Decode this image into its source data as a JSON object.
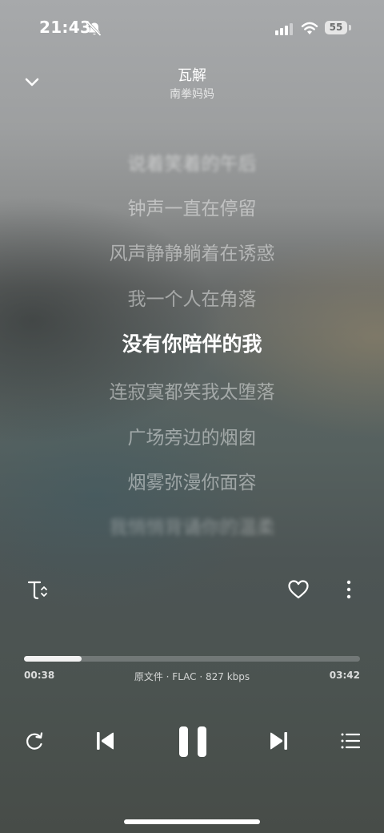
{
  "status_bar": {
    "time": "21:43",
    "battery_level": "55",
    "icons": [
      "bell-muted-icon",
      "cellular-signal-icon",
      "wifi-icon",
      "battery-icon"
    ]
  },
  "header": {
    "title": "瓦解",
    "artist": "南拳妈妈",
    "collapse_icon": "chevron-down-icon"
  },
  "lyrics": {
    "lines": [
      "说着笑着的午后",
      "钟声一直在停留",
      "风声静静躺着在诱惑",
      "我一个人在角落",
      "没有你陪伴的我",
      "连寂寞都笑我太堕落",
      "广场旁边的烟囱",
      "烟雾弥漫你面容",
      "我悄悄背诵你的温柔"
    ],
    "active_index": 4
  },
  "actions": {
    "text_size_icon": "text-size-icon",
    "like_icon": "heart-icon",
    "more_icon": "more-vertical-icon"
  },
  "progress": {
    "elapsed": "00:38",
    "total": "03:42",
    "fraction": 0.171,
    "file_info": "原文件 · FLAC · 827 kbps"
  },
  "controls": {
    "repeat_icon": "repeat-icon",
    "prev_icon": "skip-previous-icon",
    "pause_icon": "pause-icon",
    "next_icon": "skip-next-icon",
    "playlist_icon": "playlist-icon"
  },
  "colors": {
    "active_lyric": "#ffffff",
    "progress_fill": "#f2f2f2"
  }
}
